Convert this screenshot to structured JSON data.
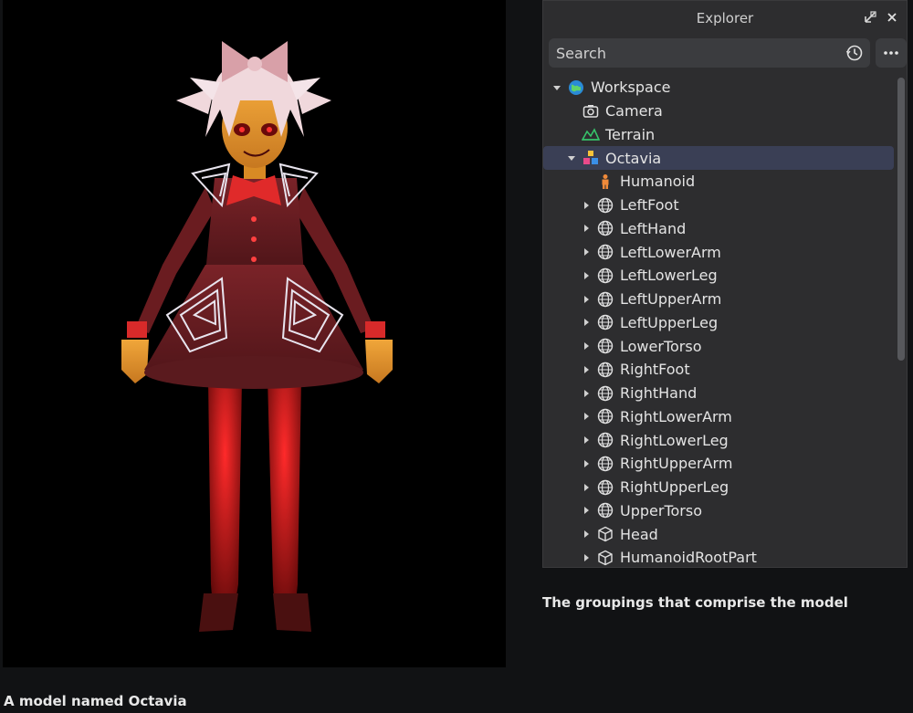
{
  "captions": {
    "left": "A model named Octavia",
    "right": "The groupings that comprise the model"
  },
  "explorer": {
    "title": "Explorer",
    "search_placeholder": "Search",
    "tree": [
      {
        "label": "Workspace",
        "depth": 0,
        "expander": "expanded",
        "icon": "workspace-globe-icon"
      },
      {
        "label": "Camera",
        "depth": 1,
        "expander": "none",
        "icon": "camera-icon"
      },
      {
        "label": "Terrain",
        "depth": 1,
        "expander": "none",
        "icon": "terrain-icon"
      },
      {
        "label": "Octavia",
        "depth": 1,
        "expander": "expanded",
        "icon": "model-icon",
        "selected": true
      },
      {
        "label": "Humanoid",
        "depth": 2,
        "expander": "none",
        "icon": "humanoid-icon"
      },
      {
        "label": "LeftFoot",
        "depth": 2,
        "expander": "collapsed",
        "icon": "meshpart-icon"
      },
      {
        "label": "LeftHand",
        "depth": 2,
        "expander": "collapsed",
        "icon": "meshpart-icon"
      },
      {
        "label": "LeftLowerArm",
        "depth": 2,
        "expander": "collapsed",
        "icon": "meshpart-icon"
      },
      {
        "label": "LeftLowerLeg",
        "depth": 2,
        "expander": "collapsed",
        "icon": "meshpart-icon"
      },
      {
        "label": "LeftUpperArm",
        "depth": 2,
        "expander": "collapsed",
        "icon": "meshpart-icon"
      },
      {
        "label": "LeftUpperLeg",
        "depth": 2,
        "expander": "collapsed",
        "icon": "meshpart-icon"
      },
      {
        "label": "LowerTorso",
        "depth": 2,
        "expander": "collapsed",
        "icon": "meshpart-icon"
      },
      {
        "label": "RightFoot",
        "depth": 2,
        "expander": "collapsed",
        "icon": "meshpart-icon"
      },
      {
        "label": "RightHand",
        "depth": 2,
        "expander": "collapsed",
        "icon": "meshpart-icon"
      },
      {
        "label": "RightLowerArm",
        "depth": 2,
        "expander": "collapsed",
        "icon": "meshpart-icon"
      },
      {
        "label": "RightLowerLeg",
        "depth": 2,
        "expander": "collapsed",
        "icon": "meshpart-icon"
      },
      {
        "label": "RightUpperArm",
        "depth": 2,
        "expander": "collapsed",
        "icon": "meshpart-icon"
      },
      {
        "label": "RightUpperLeg",
        "depth": 2,
        "expander": "collapsed",
        "icon": "meshpart-icon"
      },
      {
        "label": "UpperTorso",
        "depth": 2,
        "expander": "collapsed",
        "icon": "meshpart-icon"
      },
      {
        "label": "Head",
        "depth": 2,
        "expander": "collapsed",
        "icon": "part-cube-icon"
      },
      {
        "label": "HumanoidRootPart",
        "depth": 2,
        "expander": "collapsed",
        "icon": "part-cube-icon"
      }
    ]
  },
  "colors": {
    "background": "#111214",
    "panel": "#2d2d2f",
    "selection": "#3a3f55",
    "dress_red": "#6e1e22",
    "skin_orange": "#e0962a",
    "hair_white": "#f0d8dc",
    "web_white": "#e8e4ee"
  }
}
